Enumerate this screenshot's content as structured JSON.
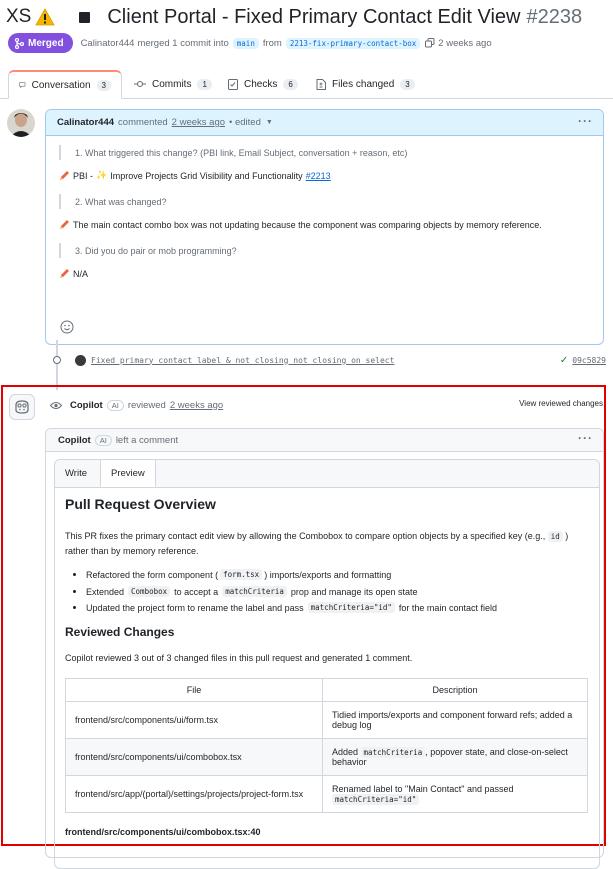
{
  "pr": {
    "size_label": "XS",
    "title": "Client Portal - Fixed Primary Contact Edit View",
    "number": "#2238",
    "status": "Merged",
    "meta_author": "Calinator444",
    "meta_text": "merged 1 commit into",
    "base_branch": "main",
    "from_text": "from",
    "head_branch": "2213-fix-primary-contact-box",
    "merged_time": "2 weeks ago"
  },
  "tabs": [
    {
      "label": "Conversation",
      "count": "3"
    },
    {
      "label": "Commits",
      "count": "1"
    },
    {
      "label": "Checks",
      "count": "6"
    },
    {
      "label": "Files changed",
      "count": "3"
    }
  ],
  "comment1": {
    "author": "Calinator444",
    "action": "commented",
    "time": "2 weeks ago",
    "edited": "• edited",
    "q1": "1. What triggered this change? (PBI link, Email Subject, conversation + reason, etc)",
    "a1_prefix": "PBI -",
    "a1_text": "Improve Projects Grid Visibility and Functionality",
    "a1_link": "#2213",
    "q2": "2. What was changed?",
    "a2": "The main contact combo box was not updating because the component was comparing objects by memory reference.",
    "q3": "3. Did you do pair or mob programming?",
    "a3": "N/A"
  },
  "commit": {
    "message": "Fixed primary contact label & not closing not closing on select",
    "sha": "09c5829"
  },
  "review": {
    "author": "Copilot",
    "ai_badge": "AI",
    "action": "reviewed",
    "time": "2 weeks ago",
    "view_link": "View reviewed changes"
  },
  "comment2": {
    "author": "Copilot",
    "ai_badge": "AI",
    "action": "left a comment",
    "tab_write": "Write",
    "tab_preview": "Preview",
    "heading": "Pull Request Overview",
    "intro_1": "This PR fixes the primary contact edit view by allowing the Combobox to compare option objects by a specified key (e.g.,",
    "intro_code": "id",
    "intro_2": ")",
    "intro_3": "rather than by memory reference.",
    "b1_pre": "Refactored the form component (",
    "b1_code": "form.tsx",
    "b1_post": ") imports/exports and formatting",
    "b2_pre": "Extended",
    "b2_code1": "Combobox",
    "b2_mid": "to accept a",
    "b2_code2": "matchCriteria",
    "b2_post": "prop and manage its open state",
    "b3_pre": "Updated the project form to rename the label and pass",
    "b3_code": "matchCriteria=\"id\"",
    "b3_post": "for the main contact field",
    "reviewed_heading": "Reviewed Changes",
    "reviewed_text": "Copilot reviewed 3 out of 3 changed files in this pull request and generated 1 comment.",
    "table_headers": [
      "File",
      "Description"
    ],
    "rows": [
      {
        "file": "frontend/src/components/ui/form.tsx",
        "desc": "Tidied imports/exports and component forward refs; added a debug log"
      },
      {
        "file": "frontend/src/components/ui/combobox.tsx",
        "desc_pre": "Added",
        "desc_code": "matchCriteria",
        "desc_post": ", popover state, and close-on-select behavior"
      },
      {
        "file": "frontend/src/app/(portal)/settings/projects/project-form.tsx",
        "desc_pre": "Renamed label to \"Main Contact\" and passed",
        "desc_code": "matchCriteria=\"id\""
      }
    ],
    "footer_file": "frontend/src/components/ui/combobox.tsx:40"
  },
  "colors": {
    "merged": "#8250df",
    "link": "#0969da",
    "highlight": "#e00000",
    "tab_accent": "#fd8c73"
  }
}
